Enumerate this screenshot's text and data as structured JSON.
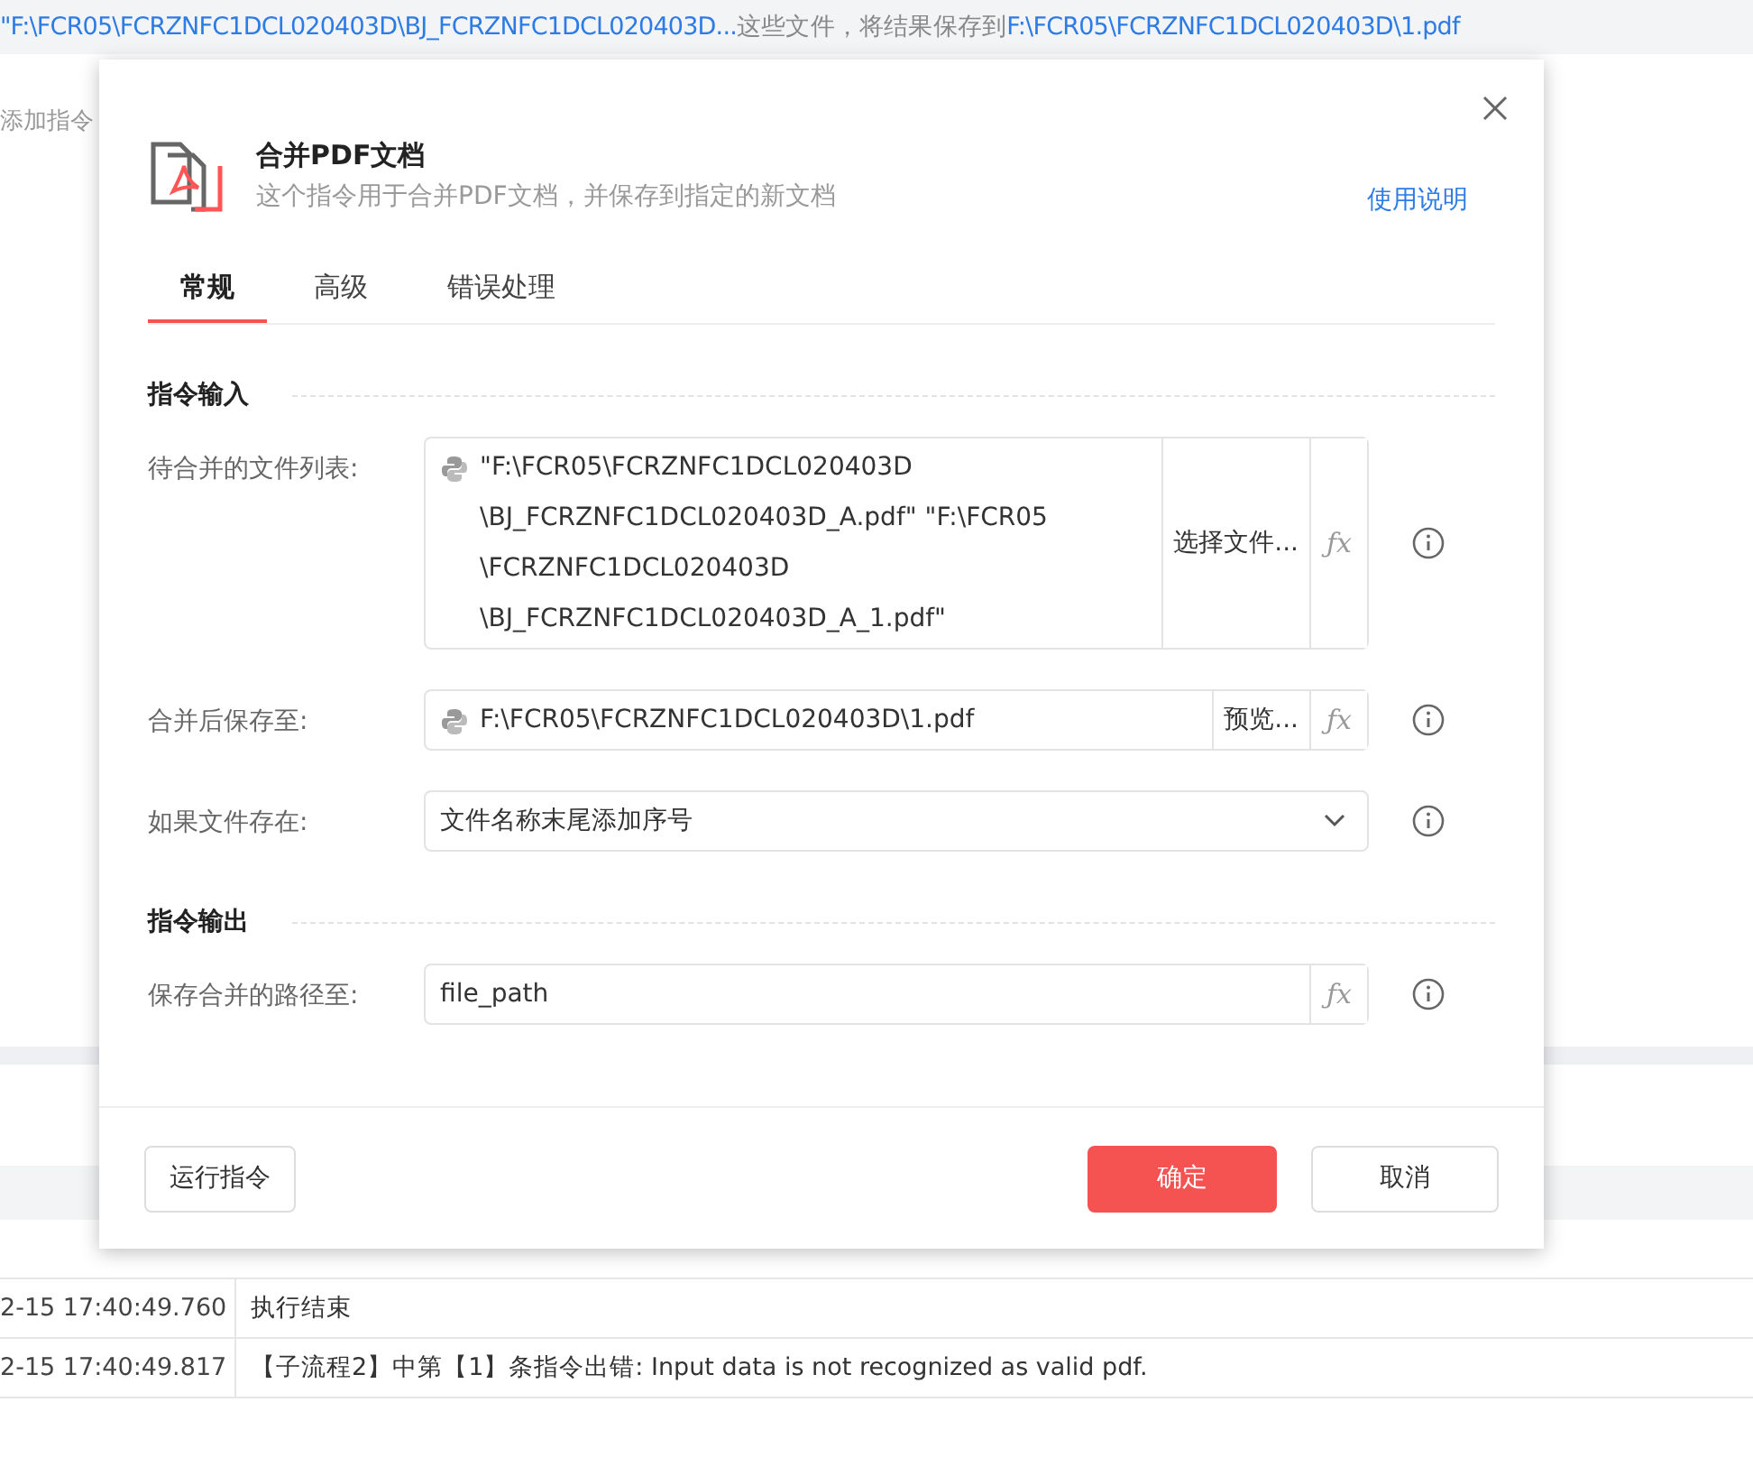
{
  "top_bar": {
    "segments": [
      {
        "kind": "path",
        "text": "\"F:\\FCR05\\FCRZNFC1DCL020403D\\BJ_FCRZNFC1DCL020403D..."
      },
      {
        "kind": "plain",
        "text": "这些文件，将结果保存到"
      },
      {
        "kind": "path",
        "text": "F:\\FCR05\\FCRZNFC1DCL020403D\\1.pdf"
      }
    ]
  },
  "add_command_label": "添加指令",
  "log_table": {
    "rows": [
      {
        "time": "2-15 17:40:49.760",
        "message": "执行结束"
      },
      {
        "time": "2-15 17:40:49.817",
        "message": "【子流程2】中第【1】条指令出错: Input data is not recognized as valid pdf."
      }
    ]
  },
  "dialog": {
    "title": "合并PDF文档",
    "subtitle": "这个指令用于合并PDF文档，并保存到指定的新文档",
    "help_link": "使用说明",
    "tabs": [
      {
        "label": "常规",
        "selected": true
      },
      {
        "label": "高级",
        "selected": false
      },
      {
        "label": "错误处理",
        "selected": false
      }
    ],
    "sections": [
      {
        "title": "指令输入",
        "fields": [
          {
            "kind": "python",
            "label": "待合并的文件列表:",
            "value": "\"F:\\FCR05\\FCRZNFC1DCL020403D \\BJ_FCRZNFC1DCL020403D_A.pdf\" \"F:\\FCR05 \\FCRZNFC1DCL020403D \\BJ_FCRZNFC1DCL020403D_A_1.pdf\"",
            "action": "选择文件...",
            "fx": "ƒx"
          },
          {
            "kind": "python",
            "label": "合并后保存至:",
            "value": "F:\\FCR05\\FCRZNFC1DCL020403D\\1.pdf",
            "action": "预览...",
            "fx": "ƒx"
          },
          {
            "kind": "select",
            "label": "如果文件存在:",
            "value": "文件名称末尾添加序号"
          }
        ]
      },
      {
        "title": "指令输出",
        "fields": [
          {
            "kind": "variable",
            "label": "保存合并的路径至:",
            "value": "file_path",
            "fx": "ƒx"
          }
        ]
      }
    ],
    "footer": {
      "run_button": "运行指令",
      "ok_button": "确定",
      "cancel_button": "取消"
    }
  }
}
